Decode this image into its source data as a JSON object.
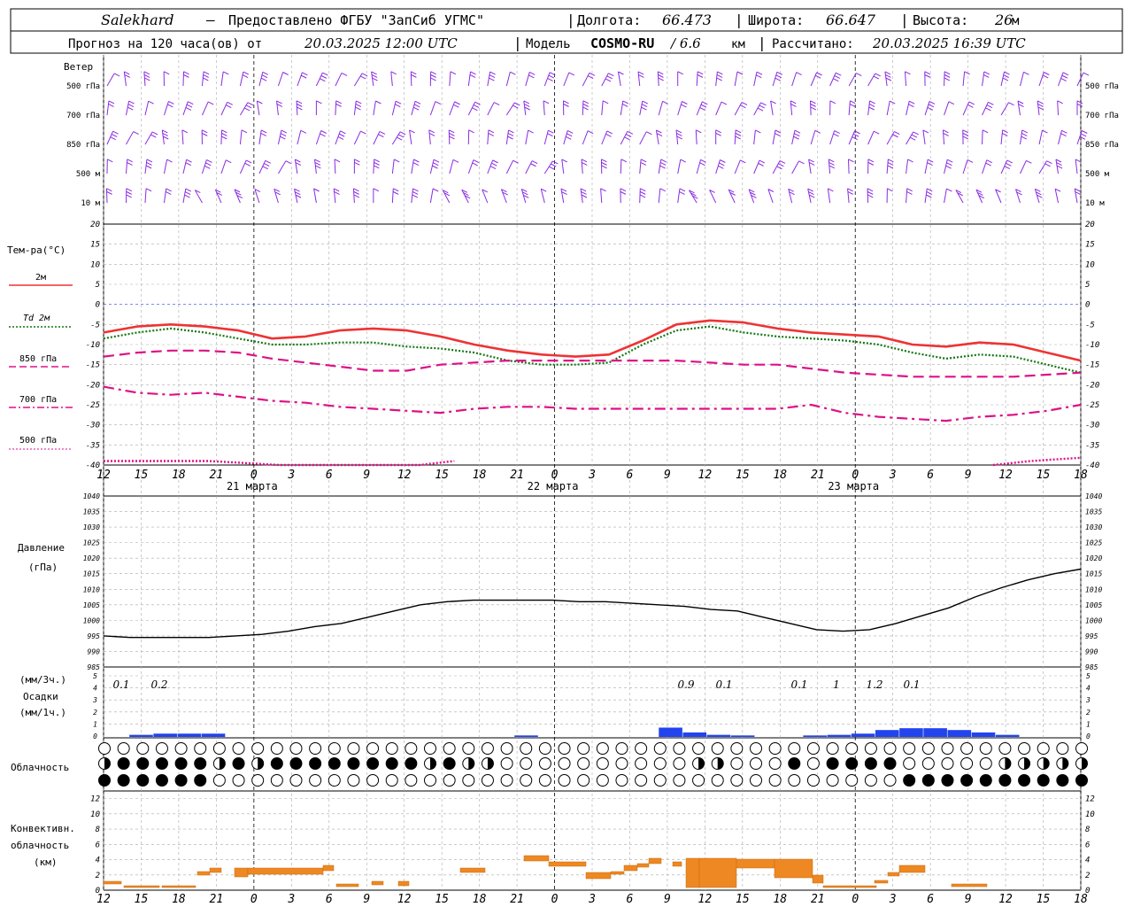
{
  "header": {
    "line1": {
      "station": "Salekhard",
      "dash": "–",
      "provider": "Предоставлено ФГБУ \"ЗапСиб УГМС\"",
      "lon_label": "Долгота:",
      "lon_value": "66.473",
      "lat_label": "Широта:",
      "lat_value": "66.647",
      "alt_label": "Высота:",
      "alt_value": "26",
      "alt_unit": "м"
    },
    "line2": {
      "forecast_prefix": "Прогноз на 120 часа(ов) от",
      "forecast_start": "20.03.2025 12:00 UTC",
      "model_label": "Модель",
      "model_name": "COSMO-RU",
      "resolution": "/ 6.6",
      "resolution_unit": "км",
      "computed_label": "Рассчитано:",
      "computed_value": "20.03.2025 16:39 UTC"
    }
  },
  "panels": {
    "wind": {
      "title": "Ветер",
      "levels": [
        "500 гПа",
        "700 гПа",
        "850 гПа",
        "500 м",
        "10 м"
      ],
      "right_levels": [
        "500 гПа",
        "700 гПа",
        "850 гПа",
        "500 м",
        "10 м"
      ],
      "barb_color": "#8a2be2"
    },
    "temperature": {
      "title": "Тем-ра(°C)",
      "y_ticks": [
        "20",
        "15",
        "10",
        "5",
        "0",
        "-5",
        "-10",
        "-15",
        "-20",
        "-25",
        "-30",
        "-35",
        "-40"
      ],
      "legend": [
        {
          "label": "2м",
          "color": "#ee3333",
          "style": "solid"
        },
        {
          "label": "Td  2м",
          "color": "#117711",
          "style": "dotted"
        },
        {
          "label": "850 гПа",
          "color": "#dd1188",
          "style": "dash"
        },
        {
          "label": "700 гПа",
          "color": "#dd1188",
          "style": "dashdot"
        },
        {
          "label": "500 гПа",
          "color": "#dd1188",
          "style": "dotted"
        }
      ]
    },
    "pressure": {
      "title": "Давление",
      "unit": "(гПа)",
      "y_ticks": [
        "1040",
        "1035",
        "1030",
        "1025",
        "1020",
        "1015",
        "1010",
        "1005",
        "1000",
        "995",
        "990",
        "985"
      ]
    },
    "precip": {
      "unit_top": "(мм/3ч.)",
      "title": "Осадки",
      "unit_bottom": "(мм/1ч.)",
      "y_ticks": [
        "5",
        "4",
        "3",
        "2",
        "1",
        "0"
      ],
      "labels": [
        "0.1",
        "0.2",
        "0.9",
        "0.1",
        "0.1",
        "1",
        "1.2",
        "0.1"
      ],
      "bar_color": "#2244ee"
    },
    "cloud": {
      "title": "Облачность"
    },
    "convective": {
      "title_1": "Конвективн.",
      "title_2": "облачность",
      "unit": "(км)",
      "y_ticks": [
        "12",
        "10",
        "8",
        "6",
        "4",
        "2",
        "0"
      ],
      "bar_color": "#ee8822"
    }
  },
  "time_axis": {
    "hour_labels": [
      "12",
      "15",
      "18",
      "21",
      "0",
      "3",
      "6",
      "9",
      "12",
      "15",
      "18",
      "21",
      "0",
      "3",
      "6",
      "9",
      "12",
      "15",
      "18",
      "21",
      "0",
      "3",
      "6",
      "9",
      "12",
      "15",
      "18"
    ],
    "date_labels": [
      "21 марта",
      "22 марта",
      "23 марта"
    ]
  },
  "chart_data": [
    {
      "type": "line",
      "title": "Тем-ра(°C)",
      "x_hours": [
        0,
        3,
        6,
        9,
        12,
        15,
        18,
        21,
        24,
        27,
        30,
        33,
        36,
        39,
        42,
        45,
        48,
        51,
        54,
        57,
        60,
        63,
        66,
        69,
        72,
        75,
        78
      ],
      "ylim": [
        -40,
        20
      ],
      "series": [
        {
          "name": "2м",
          "values": [
            -7,
            -5.5,
            -5,
            -5.5,
            -6.5,
            -8.5,
            -8,
            -6.5,
            -6,
            -6.5,
            -8,
            -10,
            -11.5,
            -12.5,
            -13,
            -12.5,
            -9,
            -5,
            -4,
            -4.5,
            -6,
            -7,
            -7.5,
            -8,
            -10,
            -10.5,
            -9.5,
            -10,
            -12,
            -14
          ]
        },
        {
          "name": "Td  2м",
          "values": [
            -8.5,
            -7,
            -6,
            -7,
            -8.5,
            -10,
            -10,
            -9.5,
            -9.5,
            -10.5,
            -11,
            -12,
            -14,
            -15,
            -15,
            -14.5,
            -10,
            -6.5,
            -5.5,
            -7,
            -8,
            -8.5,
            -9,
            -10,
            -12,
            -13.5,
            -12.5,
            -13,
            -15,
            -17
          ]
        },
        {
          "name": "850 гПа",
          "values": [
            -13,
            -12,
            -11.5,
            -11.5,
            -12,
            -13.5,
            -14.5,
            -15.5,
            -16.5,
            -16.5,
            -15,
            -14.5,
            -14,
            -14,
            -14,
            -14,
            -14,
            -14,
            -14.5,
            -15,
            -15,
            -16,
            -17,
            -17.5,
            -18,
            -18,
            -18,
            -18,
            -17.5,
            -17
          ]
        },
        {
          "name": "700 гПа",
          "values": [
            -20.5,
            -22,
            -22.5,
            -22,
            -23,
            -24,
            -24.5,
            -25.5,
            -26,
            -26.5,
            -27,
            -26,
            -25.5,
            -25.5,
            -26,
            -26,
            -26,
            -26,
            -26,
            -26,
            -26,
            -25,
            -27,
            -28,
            -28.5,
            -29,
            -28,
            -27.5,
            -26.5,
            -25
          ]
        },
        {
          "name": "500 гПа",
          "values": [
            -39,
            -39,
            -39,
            -39,
            -39.5,
            -40,
            -40,
            -40,
            -40.5,
            -41,
            -39,
            -38.5,
            -40
          ]
        }
      ]
    },
    {
      "type": "line",
      "title": "Давление",
      "x_hours": [
        0,
        3,
        6,
        9,
        12,
        15,
        18,
        21,
        24,
        27,
        30,
        33,
        36,
        39,
        42,
        45,
        48,
        51,
        54,
        57,
        60,
        63,
        66,
        69,
        72,
        75,
        78
      ],
      "ylim": [
        985,
        1040
      ],
      "series": [
        {
          "name": "Давление",
          "values": [
            995,
            994.5,
            994.5,
            994.5,
            994.5,
            995,
            995.5,
            996.5,
            998,
            999,
            1001,
            1003,
            1005,
            1006,
            1006.5,
            1006.5,
            1006.5,
            1006.5,
            1006,
            1006,
            1005.5,
            1005,
            1004.5,
            1003.5,
            1003,
            1001,
            999,
            997,
            996.5,
            997,
            999,
            1001.5,
            1004,
            1007.5,
            1010.5,
            1013,
            1015,
            1016.5
          ]
        }
      ]
    },
    {
      "type": "bar",
      "title": "Осадки",
      "ylim": [
        0,
        5
      ],
      "series": [
        {
          "name": "Осадки",
          "values": [
            0,
            0.1,
            0.2,
            0.2,
            0.2,
            0,
            0,
            0,
            0,
            0,
            0,
            0,
            0,
            0,
            0,
            0,
            0,
            0.05,
            0,
            0,
            0,
            0,
            0,
            0.7,
            0.3,
            0.1,
            0.05,
            0,
            0,
            0.05,
            0.1,
            0.2,
            0.5,
            0.65,
            0.65,
            0.5,
            0.3,
            0.1,
            0,
            0
          ]
        }
      ]
    },
    {
      "type": "bar",
      "title": "Конвективн. облачность",
      "ylim": [
        0,
        13
      ]
    }
  ]
}
